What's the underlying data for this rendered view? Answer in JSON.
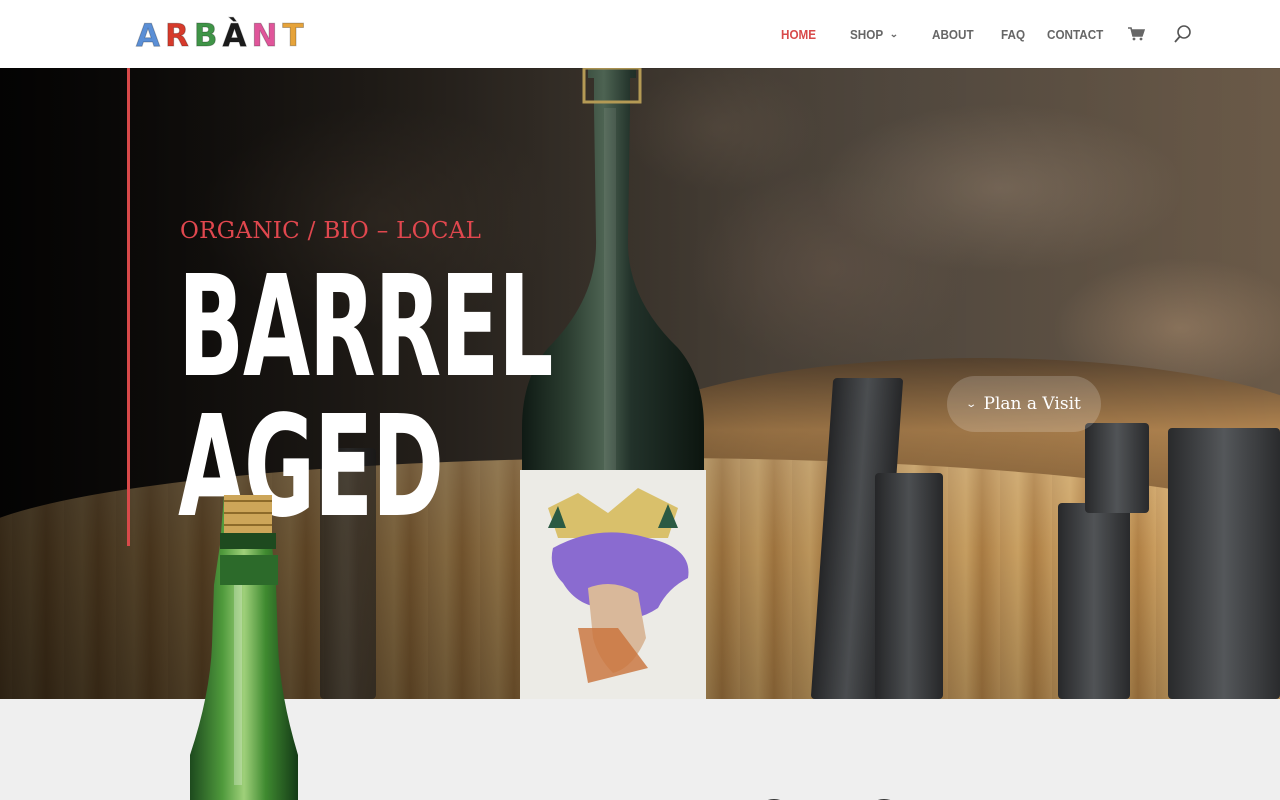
{
  "brand": {
    "logo_letters": [
      "A",
      "R",
      "B",
      "À",
      "N",
      "T"
    ],
    "logo_colors": [
      "#5b8fd6",
      "#d63a2b",
      "#3f9447",
      "#1b1b1b",
      "#e0559a",
      "#e6a33a"
    ]
  },
  "nav": {
    "items": [
      {
        "label": "HOME",
        "active": true
      },
      {
        "label": "SHOP",
        "has_dropdown": true
      },
      {
        "label": "ABOUT"
      },
      {
        "label": "FAQ"
      },
      {
        "label": "CONTACT"
      }
    ],
    "cart_icon": "cart-icon",
    "search_icon": "search-icon"
  },
  "hero": {
    "subtitle": "ORGANIC / BIO – LOCAL",
    "title_line1": "BARREL",
    "title_line2": "AGED",
    "cta_label": "Plan a Visit",
    "cta_icon": "chevron-down-icon"
  },
  "colors": {
    "accent": "#d84a4a",
    "nav_text": "#666666",
    "hero_title": "#ffffff"
  }
}
